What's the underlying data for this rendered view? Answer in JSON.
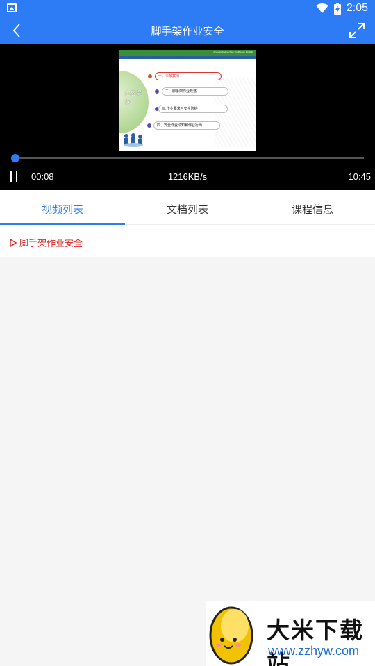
{
  "status_bar": {
    "time": "2:05",
    "icons": [
      "gallery-icon",
      "wifi-icon",
      "battery-charging-icon"
    ]
  },
  "app_bar": {
    "title": "脚手架作业安全",
    "back_icon": "chevron-left-icon",
    "fullscreen_icon": "expand-icon"
  },
  "player": {
    "current_time": "00:08",
    "speed": "1216KB/s",
    "total_time": "10:45",
    "progress": 0.012,
    "slide": {
      "banner_text": "Anquan Shengchan YunPeixun Pingtai",
      "circle_title": "内容提纲",
      "items": [
        "一、事故案例",
        "二、脚手架作业概述",
        "三.作业要求与安全防护",
        "四、安全作业须知和作业行为"
      ]
    }
  },
  "tabs": [
    {
      "label": "视频列表",
      "active": true
    },
    {
      "label": "文档列表",
      "active": false
    },
    {
      "label": "课程信息",
      "active": false
    }
  ],
  "video_list": [
    {
      "label": "脚手架作业安全",
      "playing": true
    }
  ],
  "watermark": {
    "title": "大米下载站",
    "url": "www.zzhyw.com"
  },
  "colors": {
    "primary": "#2d7bf5",
    "active_item": "#e02020",
    "background": "#f5f5f5"
  }
}
